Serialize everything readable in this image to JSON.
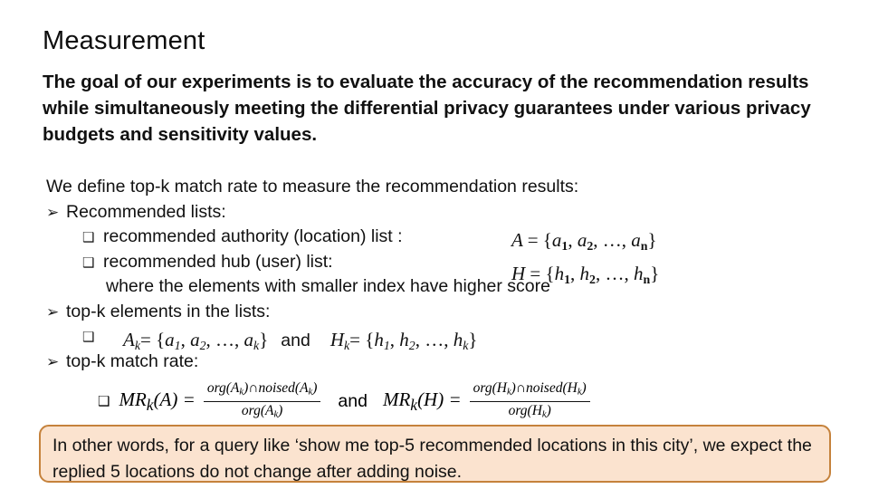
{
  "slide": {
    "title": "Measurement",
    "intro": "The goal of our experiments is to evaluate the accuracy of the recommendation results while simultaneously meeting the differential privacy guarantees under various privacy budgets and sensitivity values.",
    "define_line": "We define top-k match rate to measure the recommendation results:",
    "bullets": {
      "recommended_lists": "Recommended lists:",
      "authority_list": "recommended authority (location) list :",
      "hub_list": "recommended hub (user) list:",
      "where_note": "where the elements with smaller index have higher score",
      "topk_elements": "top-k elements in the lists:",
      "topk_match_rate": "top-k match rate:"
    },
    "icons": {
      "arrow_bullet": "➢",
      "square_bullet": "❑"
    },
    "math": {
      "set_A": {
        "lhs": "A",
        "eq": "= {",
        "e1": "a",
        "s1": "1",
        "e2": "a",
        "s2": "2",
        "ellipsis": ", …, ",
        "en": "a",
        "sn": "n",
        "close": "}"
      },
      "set_H": {
        "lhs": "H",
        "eq": "= {",
        "e1": "h",
        "s1": "1",
        "e2": "h",
        "s2": "2",
        "ellipsis": ", …, ",
        "en": "h",
        "sn": "n",
        "close": "}"
      },
      "topk_A": {
        "lhs": "A",
        "lhs_sub": "k",
        "eq": "= {",
        "e1": "a",
        "s1": "1",
        "e2": "a",
        "s2": "2",
        "ellipsis": ", …, ",
        "ek": "a",
        "sk": "k",
        "close": "}"
      },
      "topk_H": {
        "lhs": "H",
        "lhs_sub": "k",
        "eq": "= {",
        "e1": "h",
        "s1": "1",
        "e2": "h",
        "s2": "2",
        "ellipsis": ", …, ",
        "ek": "h",
        "sk": "k",
        "close": "}"
      },
      "and_word": "and",
      "mr_A": {
        "lhs": "MR",
        "lhs_sub": "k",
        "arg": "(A)",
        "eq": "=",
        "numerator_1": "org(A",
        "numerator_sub1": "k",
        "numerator_2": ")∩noised(A",
        "numerator_sub2": "k",
        "numerator_3": ")",
        "denominator_1": "org(A",
        "denominator_sub": "k",
        "denominator_2": ")"
      },
      "mr_H": {
        "lhs": "MR",
        "lhs_sub": "k",
        "arg": "(H)",
        "eq": "=",
        "numerator_1": "org(H",
        "numerator_sub1": "k",
        "numerator_2": ")∩noised(H",
        "numerator_sub2": "k",
        "numerator_3": ")",
        "denominator_1": "org(H",
        "denominator_sub": "k",
        "denominator_2": ")"
      }
    },
    "callout": {
      "text": "In other words, for a query like ‘show me top-5 recommended locations in this city’, we expect the replied 5 locations do not change after adding noise.",
      "fill_color": "#FBE3CF",
      "border_color": "#C5823C"
    }
  }
}
